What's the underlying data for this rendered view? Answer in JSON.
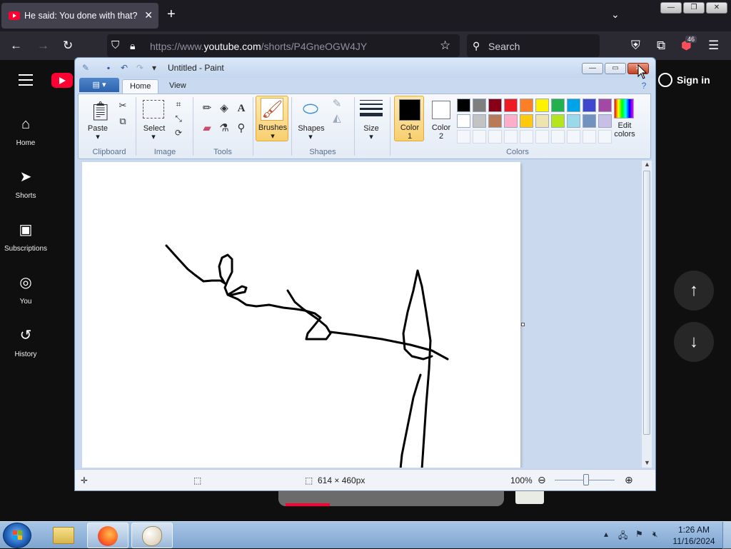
{
  "browser": {
    "tab_title": "He said: You done with that? I'm",
    "tab_close": "✕",
    "new_tab": "+",
    "url": {
      "scheme": "https://www.",
      "domain": "youtube.com",
      "path": "/shorts/P4GneOGW4JY"
    },
    "search_placeholder": "Search",
    "extension_badge": "46",
    "window_controls": {
      "minimize": "—",
      "restore": "❐",
      "close": "✕"
    }
  },
  "youtube": {
    "sidebar": [
      {
        "label": "Home",
        "icon": "home-icon"
      },
      {
        "label": "Shorts",
        "icon": "shorts-icon"
      },
      {
        "label": "Subscriptions",
        "icon": "subscriptions-icon"
      },
      {
        "label": "You",
        "icon": "you-icon"
      },
      {
        "label": "History",
        "icon": "history-icon"
      }
    ],
    "sign_in": "Sign in",
    "nav_up": "↑",
    "nav_down": "↓"
  },
  "paint": {
    "title": "Untitled - Paint",
    "tabs": [
      "Home",
      "View"
    ],
    "active_tab": "Home",
    "groups": {
      "clipboard": {
        "label": "Clipboard",
        "paste": "Paste"
      },
      "image": {
        "label": "Image",
        "select": "Select"
      },
      "tools": {
        "label": "Tools"
      },
      "brushes": {
        "label": "Brushes"
      },
      "shapes": {
        "label": "Shapes",
        "button": "Shapes"
      },
      "size": {
        "label": "Size"
      },
      "colors": {
        "label": "Colors",
        "color1": {
          "line1": "Color",
          "line2": "1",
          "value": "#000000"
        },
        "color2": {
          "line1": "Color",
          "line2": "2",
          "value": "#ffffff"
        },
        "edit_line1": "Edit",
        "edit_line2": "colors",
        "palette_row1": [
          "#000000",
          "#7f7f7f",
          "#880015",
          "#ed1c24",
          "#ff7f27",
          "#fff200",
          "#22b14c",
          "#00a2e8",
          "#3f48cc",
          "#a349a4"
        ],
        "palette_row2": [
          "#ffffff",
          "#c3c3c3",
          "#b97a57",
          "#ffaec9",
          "#ffc90e",
          "#efe4b0",
          "#b5e61d",
          "#99d9ea",
          "#7092be",
          "#c8bfe7"
        ]
      }
    },
    "status": {
      "dimensions": "614 × 460px",
      "zoom": "100%"
    }
  },
  "taskbar": {
    "time": "1:26 AM",
    "date": "11/16/2024"
  }
}
